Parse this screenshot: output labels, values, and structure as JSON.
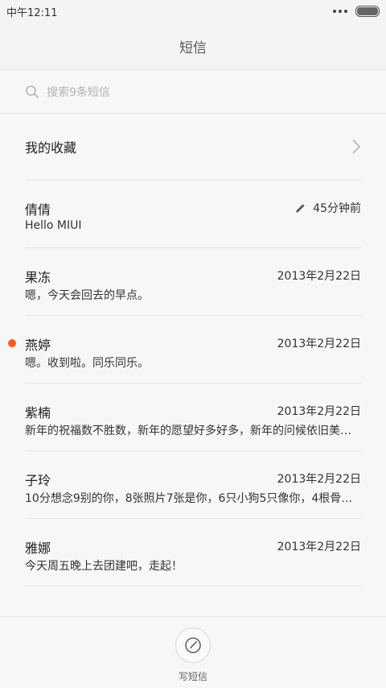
{
  "status_bar": {
    "time": "中午12:11"
  },
  "header": {
    "title": "短信"
  },
  "search": {
    "placeholder": "搜索9条短信"
  },
  "favorites": {
    "label": "我的收藏"
  },
  "conversations": [
    {
      "name": "倩倩",
      "time": "45分钟前",
      "preview": "Hello MIUI",
      "draft": true,
      "unread": false
    },
    {
      "name": "果冻",
      "time": "2013年2月22日",
      "preview": "嗯，今天会回去的早点。",
      "draft": false,
      "unread": false
    },
    {
      "name": "燕婷",
      "time": "2013年2月22日",
      "preview": "嗯。收到啦。同乐同乐。",
      "draft": false,
      "unread": true
    },
    {
      "name": "紫楠",
      "time": "2013年2月22日",
      "preview": "新年的祝福数不胜数，新年的愿望好多好多，新年的问候依旧美…",
      "draft": false,
      "unread": false
    },
    {
      "name": "子玲",
      "time": "2013年2月22日",
      "preview": "10分想念9别的你，8张照片7张是你，6只小狗5只像你，4根骨…",
      "draft": false,
      "unread": false
    },
    {
      "name": "雅娜",
      "time": "2013年2月22日",
      "preview": "今天周五晚上去团建吧，走起！",
      "draft": false,
      "unread": false
    }
  ],
  "compose": {
    "label": "写短信",
    "icon": "compose-icon"
  },
  "colors": {
    "unread_dot": "#ff5c1a",
    "accent": "#555555"
  },
  "battery_level": 1.0
}
